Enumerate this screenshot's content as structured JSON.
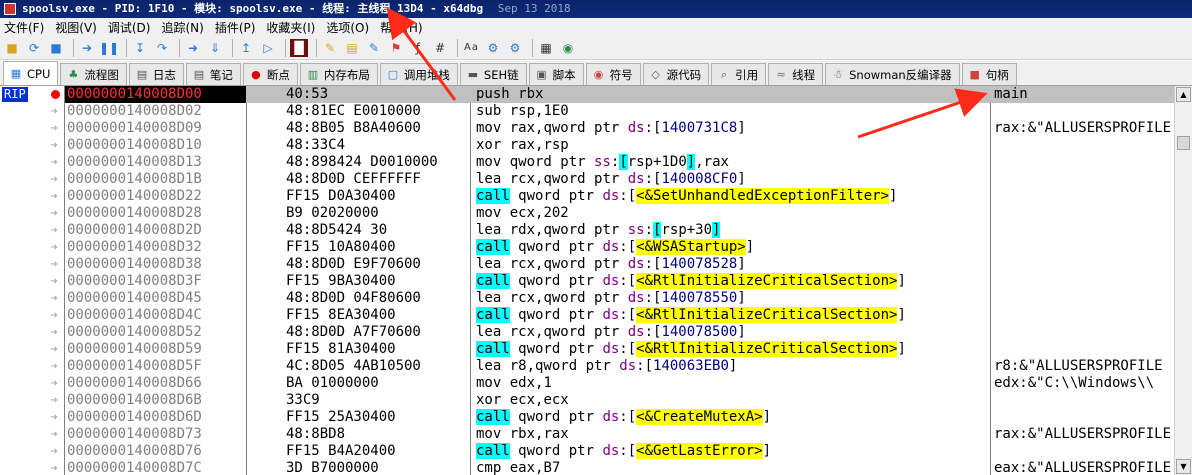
{
  "window": {
    "title": "spoolsv.exe - PID: 1F10 - 模块: spoolsv.exe - 线程: 主线程 13D4 - x64dbg",
    "build_date": "Sep 13 2018"
  },
  "menu": [
    "文件(F)",
    "视图(V)",
    "调试(D)",
    "追踪(N)",
    "插件(P)",
    "收藏夹(I)",
    "选项(O)",
    "帮助(H)"
  ],
  "tabs": [
    {
      "label": "CPU",
      "icon": "cpu-icon",
      "active": true
    },
    {
      "label": "流程图",
      "icon": "graph-icon"
    },
    {
      "label": "日志",
      "icon": "log-icon"
    },
    {
      "label": "笔记",
      "icon": "notes-icon"
    },
    {
      "label": "断点",
      "icon": "breakpoint-icon"
    },
    {
      "label": "内存布局",
      "icon": "memory-map-icon"
    },
    {
      "label": "调用堆栈",
      "icon": "call-stack-icon"
    },
    {
      "label": "SEH链",
      "icon": "seh-icon"
    },
    {
      "label": "脚本",
      "icon": "script-icon"
    },
    {
      "label": "符号",
      "icon": "symbols-icon"
    },
    {
      "label": "源代码",
      "icon": "source-icon"
    },
    {
      "label": "引用",
      "icon": "references-icon"
    },
    {
      "label": "线程",
      "icon": "threads-icon"
    },
    {
      "label": "Snowman反编译器",
      "icon": "snowman-icon"
    },
    {
      "label": "句柄",
      "icon": "handles-icon"
    }
  ],
  "rip_label": "RIP",
  "disasm": [
    {
      "addr": "0000000140008D00",
      "bytes": "40:53",
      "instr": [
        [
          "mn",
          "push "
        ],
        [
          "reg",
          "rbx"
        ]
      ],
      "comment": "main",
      "rip": true
    },
    {
      "addr": "0000000140008D02",
      "bytes": "48:81EC E0010000",
      "instr": [
        [
          "mn",
          "sub "
        ],
        [
          "reg",
          "rsp"
        ],
        [
          "br",
          ","
        ],
        [
          "num",
          "1E0"
        ]
      ],
      "comment": ""
    },
    {
      "addr": "0000000140008D09",
      "bytes": "48:8B05 B8A40600",
      "instr": [
        [
          "mn",
          "mov "
        ],
        [
          "reg",
          "rax"
        ],
        [
          "br",
          ",qword ptr "
        ],
        [
          "ds",
          "ds"
        ],
        [
          "br",
          ":["
        ],
        [
          "mem",
          "1400731C8"
        ],
        [
          "br",
          "]"
        ]
      ],
      "comment": "rax:&\"ALLUSERSPROFILE"
    },
    {
      "addr": "0000000140008D10",
      "bytes": "48:33C4",
      "instr": [
        [
          "mn",
          "xor "
        ],
        [
          "reg",
          "rax"
        ],
        [
          "br",
          ","
        ],
        [
          "reg",
          "rsp"
        ]
      ],
      "comment": ""
    },
    {
      "addr": "0000000140008D13",
      "bytes": "48:898424 D0010000",
      "instr": [
        [
          "mn",
          "mov "
        ],
        [
          "br",
          "qword ptr "
        ],
        [
          "ss",
          "ss"
        ],
        [
          "br",
          ":"
        ],
        [
          "ssb",
          "["
        ],
        [
          "reg",
          "rsp+1D0"
        ],
        [
          "ssb",
          "]"
        ],
        [
          "br",
          ","
        ],
        [
          "reg",
          "rax"
        ]
      ],
      "comment": ""
    },
    {
      "addr": "0000000140008D1B",
      "bytes": "48:8D0D CEFFFFFF",
      "instr": [
        [
          "mn",
          "lea "
        ],
        [
          "reg",
          "rcx"
        ],
        [
          "br",
          ",qword ptr "
        ],
        [
          "ds",
          "ds"
        ],
        [
          "br",
          ":["
        ],
        [
          "mem",
          "140008CF0"
        ],
        [
          "br",
          "]"
        ]
      ],
      "comment": ""
    },
    {
      "addr": "0000000140008D22",
      "bytes": "FF15 D0A30400",
      "instr": [
        [
          "call",
          "call"
        ],
        [
          "br",
          " qword ptr "
        ],
        [
          "ds",
          "ds"
        ],
        [
          "br",
          ":["
        ],
        [
          "lbl",
          "<&SetUnhandledExceptionFilter>"
        ],
        [
          "br",
          "]"
        ]
      ],
      "comment": ""
    },
    {
      "addr": "0000000140008D28",
      "bytes": "B9 02020000",
      "instr": [
        [
          "mn",
          "mov "
        ],
        [
          "reg",
          "ecx"
        ],
        [
          "br",
          ","
        ],
        [
          "num",
          "202"
        ]
      ],
      "comment": ""
    },
    {
      "addr": "0000000140008D2D",
      "bytes": "48:8D5424 30",
      "instr": [
        [
          "mn",
          "lea "
        ],
        [
          "reg",
          "rdx"
        ],
        [
          "br",
          ",qword ptr "
        ],
        [
          "ss",
          "ss"
        ],
        [
          "br",
          ":"
        ],
        [
          "ssb",
          "["
        ],
        [
          "reg",
          "rsp+30"
        ],
        [
          "ssb",
          "]"
        ]
      ],
      "comment": ""
    },
    {
      "addr": "0000000140008D32",
      "bytes": "FF15 10A80400",
      "instr": [
        [
          "call",
          "call"
        ],
        [
          "br",
          " qword ptr "
        ],
        [
          "ds",
          "ds"
        ],
        [
          "br",
          ":["
        ],
        [
          "lbl",
          "<&WSAStartup>"
        ],
        [
          "br",
          "]"
        ]
      ],
      "comment": ""
    },
    {
      "addr": "0000000140008D38",
      "bytes": "48:8D0D E9F70600",
      "instr": [
        [
          "mn",
          "lea "
        ],
        [
          "reg",
          "rcx"
        ],
        [
          "br",
          ",qword ptr "
        ],
        [
          "ds",
          "ds"
        ],
        [
          "br",
          ":["
        ],
        [
          "mem",
          "140078528"
        ],
        [
          "br",
          "]"
        ]
      ],
      "comment": ""
    },
    {
      "addr": "0000000140008D3F",
      "bytes": "FF15 9BA30400",
      "instr": [
        [
          "call",
          "call"
        ],
        [
          "br",
          " qword ptr "
        ],
        [
          "ds",
          "ds"
        ],
        [
          "br",
          ":["
        ],
        [
          "lbl",
          "<&RtlInitializeCriticalSection>"
        ],
        [
          "br",
          "]"
        ]
      ],
      "comment": ""
    },
    {
      "addr": "0000000140008D45",
      "bytes": "48:8D0D 04F80600",
      "instr": [
        [
          "mn",
          "lea "
        ],
        [
          "reg",
          "rcx"
        ],
        [
          "br",
          ",qword ptr "
        ],
        [
          "ds",
          "ds"
        ],
        [
          "br",
          ":["
        ],
        [
          "mem",
          "140078550"
        ],
        [
          "br",
          "]"
        ]
      ],
      "comment": ""
    },
    {
      "addr": "0000000140008D4C",
      "bytes": "FF15 8EA30400",
      "instr": [
        [
          "call",
          "call"
        ],
        [
          "br",
          " qword ptr "
        ],
        [
          "ds",
          "ds"
        ],
        [
          "br",
          ":["
        ],
        [
          "lbl",
          "<&RtlInitializeCriticalSection>"
        ],
        [
          "br",
          "]"
        ]
      ],
      "comment": ""
    },
    {
      "addr": "0000000140008D52",
      "bytes": "48:8D0D A7F70600",
      "instr": [
        [
          "mn",
          "lea "
        ],
        [
          "reg",
          "rcx"
        ],
        [
          "br",
          ",qword ptr "
        ],
        [
          "ds",
          "ds"
        ],
        [
          "br",
          ":["
        ],
        [
          "mem",
          "140078500"
        ],
        [
          "br",
          "]"
        ]
      ],
      "comment": ""
    },
    {
      "addr": "0000000140008D59",
      "bytes": "FF15 81A30400",
      "instr": [
        [
          "call",
          "call"
        ],
        [
          "br",
          " qword ptr "
        ],
        [
          "ds",
          "ds"
        ],
        [
          "br",
          ":["
        ],
        [
          "lbl",
          "<&RtlInitializeCriticalSection>"
        ],
        [
          "br",
          "]"
        ]
      ],
      "comment": ""
    },
    {
      "addr": "0000000140008D5F",
      "bytes": "4C:8D05 4AB10500",
      "instr": [
        [
          "mn",
          "lea "
        ],
        [
          "reg",
          "r8"
        ],
        [
          "br",
          ",qword ptr "
        ],
        [
          "ds",
          "ds"
        ],
        [
          "br",
          ":["
        ],
        [
          "mem",
          "140063EB0"
        ],
        [
          "br",
          "]"
        ]
      ],
      "comment": "r8:&\"ALLUSERSPROFILE"
    },
    {
      "addr": "0000000140008D66",
      "bytes": "BA 01000000",
      "instr": [
        [
          "mn",
          "mov "
        ],
        [
          "reg",
          "edx"
        ],
        [
          "br",
          ","
        ],
        [
          "num",
          "1"
        ]
      ],
      "comment": "edx:&\"C:\\\\Windows\\\\"
    },
    {
      "addr": "0000000140008D6B",
      "bytes": "33C9",
      "instr": [
        [
          "mn",
          "xor "
        ],
        [
          "reg",
          "ecx"
        ],
        [
          "br",
          ","
        ],
        [
          "reg",
          "ecx"
        ]
      ],
      "comment": ""
    },
    {
      "addr": "0000000140008D6D",
      "bytes": "FF15 25A30400",
      "instr": [
        [
          "call",
          "call"
        ],
        [
          "br",
          " qword ptr "
        ],
        [
          "ds",
          "ds"
        ],
        [
          "br",
          ":["
        ],
        [
          "lbl",
          "<&CreateMutexA>"
        ],
        [
          "br",
          "]"
        ]
      ],
      "comment": ""
    },
    {
      "addr": "0000000140008D73",
      "bytes": "48:8BD8",
      "instr": [
        [
          "mn",
          "mov "
        ],
        [
          "reg",
          "rbx"
        ],
        [
          "br",
          ","
        ],
        [
          "reg",
          "rax"
        ]
      ],
      "comment": "rax:&\"ALLUSERSPROFILE"
    },
    {
      "addr": "0000000140008D76",
      "bytes": "FF15 B4A20400",
      "instr": [
        [
          "call",
          "call"
        ],
        [
          "br",
          " qword ptr "
        ],
        [
          "ds",
          "ds"
        ],
        [
          "br",
          ":["
        ],
        [
          "lbl",
          "<&GetLastError>"
        ],
        [
          "br",
          "]"
        ]
      ],
      "comment": ""
    },
    {
      "addr": "0000000140008D7C",
      "bytes": "3D B7000000",
      "instr": [
        [
          "mn",
          "cmp "
        ],
        [
          "reg",
          "eax"
        ],
        [
          "br",
          ","
        ],
        [
          "num",
          "B7"
        ]
      ],
      "comment": "eax:&\"ALLUSERSPROFILE"
    }
  ],
  "colors": {
    "annotation_arrow": "#ff2a1a",
    "rip_bg": "#0033cc",
    "call_bg": "#00ffff",
    "label_bg": "#ffff00",
    "selected_row": "#c0c0c0"
  }
}
